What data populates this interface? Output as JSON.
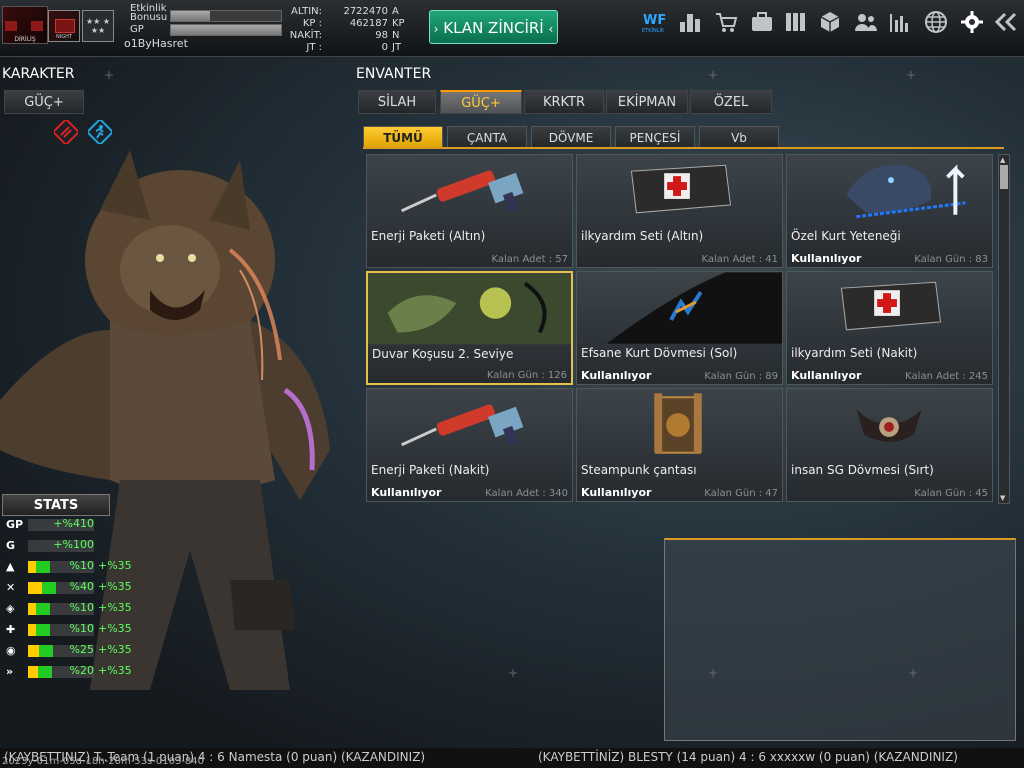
{
  "topbar": {
    "rank_logo_label": "DİRİLİŞ",
    "clan_logo_label": "NIGHT",
    "stars": "★★ ★ ★★",
    "bonus_label_1": "Etkinlik",
    "bonus_label_2": "Bonusu",
    "gp_label": "GP",
    "bonus_progress": 0.35,
    "gp_progress": 1.0,
    "username": "o1ByHasret",
    "currencies": [
      {
        "key": "ALTIN:",
        "value": "2722470",
        "unit": "A"
      },
      {
        "key": "KP :",
        "value": "462187",
        "unit": "KP"
      },
      {
        "key": "NAKİT:",
        "value": "98",
        "unit": "N"
      },
      {
        "key": "JT :",
        "value": "0",
        "unit": "JT"
      }
    ],
    "klan_button": "KLAN ZİNCİRİ",
    "klan_chevron_left": "›",
    "klan_chevron_right": "‹",
    "event_icon_text": "ETKİNLİK",
    "icons": [
      "event-icon",
      "ranking-icon",
      "cart-icon",
      "briefcase-icon",
      "lockers-icon",
      "box-icon",
      "friends-icon",
      "stats-icon",
      "globe-icon",
      "settings-icon",
      "exit-icon"
    ]
  },
  "character": {
    "title": "KARAKTER",
    "tab": "GÜÇ+",
    "stats_title": "STATS",
    "stats": [
      {
        "icon": "GP",
        "base": "+%410",
        "bonus": "",
        "yellow": 0,
        "green": 0
      },
      {
        "icon": "G",
        "base": "+%100",
        "bonus": "",
        "yellow": 0,
        "green": 0
      },
      {
        "icon": "▲",
        "base": "%10",
        "bonus": "+%35",
        "yellow": 0.12,
        "green": 0.2
      },
      {
        "icon": "✕",
        "base": "%40",
        "bonus": "+%35",
        "yellow": 0.25,
        "green": 0.2
      },
      {
        "icon": "◈",
        "base": "%10",
        "bonus": "+%35",
        "yellow": 0.12,
        "green": 0.2
      },
      {
        "icon": "✚",
        "base": "%10",
        "bonus": "+%35",
        "yellow": 0.12,
        "green": 0.2
      },
      {
        "icon": "◉",
        "base": "%25",
        "bonus": "+%35",
        "yellow": 0.18,
        "green": 0.2
      },
      {
        "icon": "»",
        "base": "%20",
        "bonus": "+%35",
        "yellow": 0.15,
        "green": 0.2
      }
    ]
  },
  "inventory": {
    "title": "ENVANTER",
    "tabs": [
      {
        "label": "SİLAH"
      },
      {
        "label": "GÜÇ+"
      },
      {
        "label": "KRKTR"
      },
      {
        "label": "EKİPMAN"
      },
      {
        "label": "ÖZEL"
      }
    ],
    "active_tab": "GÜÇ+",
    "subtabs": [
      {
        "label": "TÜMÜ"
      },
      {
        "label": "ÇANTA"
      },
      {
        "label": "DÖVME"
      },
      {
        "label": "PENÇESİ"
      },
      {
        "label": "Vb"
      }
    ],
    "active_subtab": "TÜMÜ",
    "items": [
      {
        "name": "Enerji Paketi (Altın)",
        "status": "",
        "remaining": "Kalan Adet : 57",
        "art": "syringe"
      },
      {
        "name": "ilkyardım Seti (Altın)",
        "status": "",
        "remaining": "Kalan Adet : 41",
        "art": "medkit"
      },
      {
        "name": "Özel Kurt Yeteneği",
        "status": "Kullanılıyor",
        "remaining": "Kalan Gün : 83",
        "art": "wolf"
      },
      {
        "name": "Duvar Koşusu 2. Seviye",
        "status": "",
        "remaining": "Kalan Gün : 126",
        "art": "wallrun"
      },
      {
        "name": "Efsane Kurt Dövmesi (Sol)",
        "status": "Kullanılıyor",
        "remaining": "Kalan Gün : 89",
        "art": "tattoo"
      },
      {
        "name": "ilkyardım Seti (Nakit)",
        "status": "Kullanılıyor",
        "remaining": "Kalan Adet : 245",
        "art": "medkit"
      },
      {
        "name": "Enerji Paketi (Nakit)",
        "status": "Kullanılıyor",
        "remaining": "Kalan Adet : 340",
        "art": "syringe"
      },
      {
        "name": "Steampunk çantası",
        "status": "Kullanılıyor",
        "remaining": "Kalan Gün : 47",
        "art": "steampunk"
      },
      {
        "name": "insan SG Dövmesi (Sırt)",
        "status": "",
        "remaining": "Kalan Gün : 45",
        "art": "emblem"
      }
    ]
  },
  "ticker": {
    "left": "(KAYBETTINIZ) T..Team (1 puan) 4 : 6 Namesta (0 puan) (KAZANDINIZ)",
    "right": "(KAYBETTİNİZ) BLESTY (14 puan) 4 : 6 xxxxxw (0 puan) (KAZANDINIZ)",
    "clock": "2023y-01m-05d-18h-20m-53s-0103-840"
  },
  "colors": {
    "accent": "#ffcc33",
    "klan": "#1fa77a",
    "status_green": "#22cc22"
  }
}
